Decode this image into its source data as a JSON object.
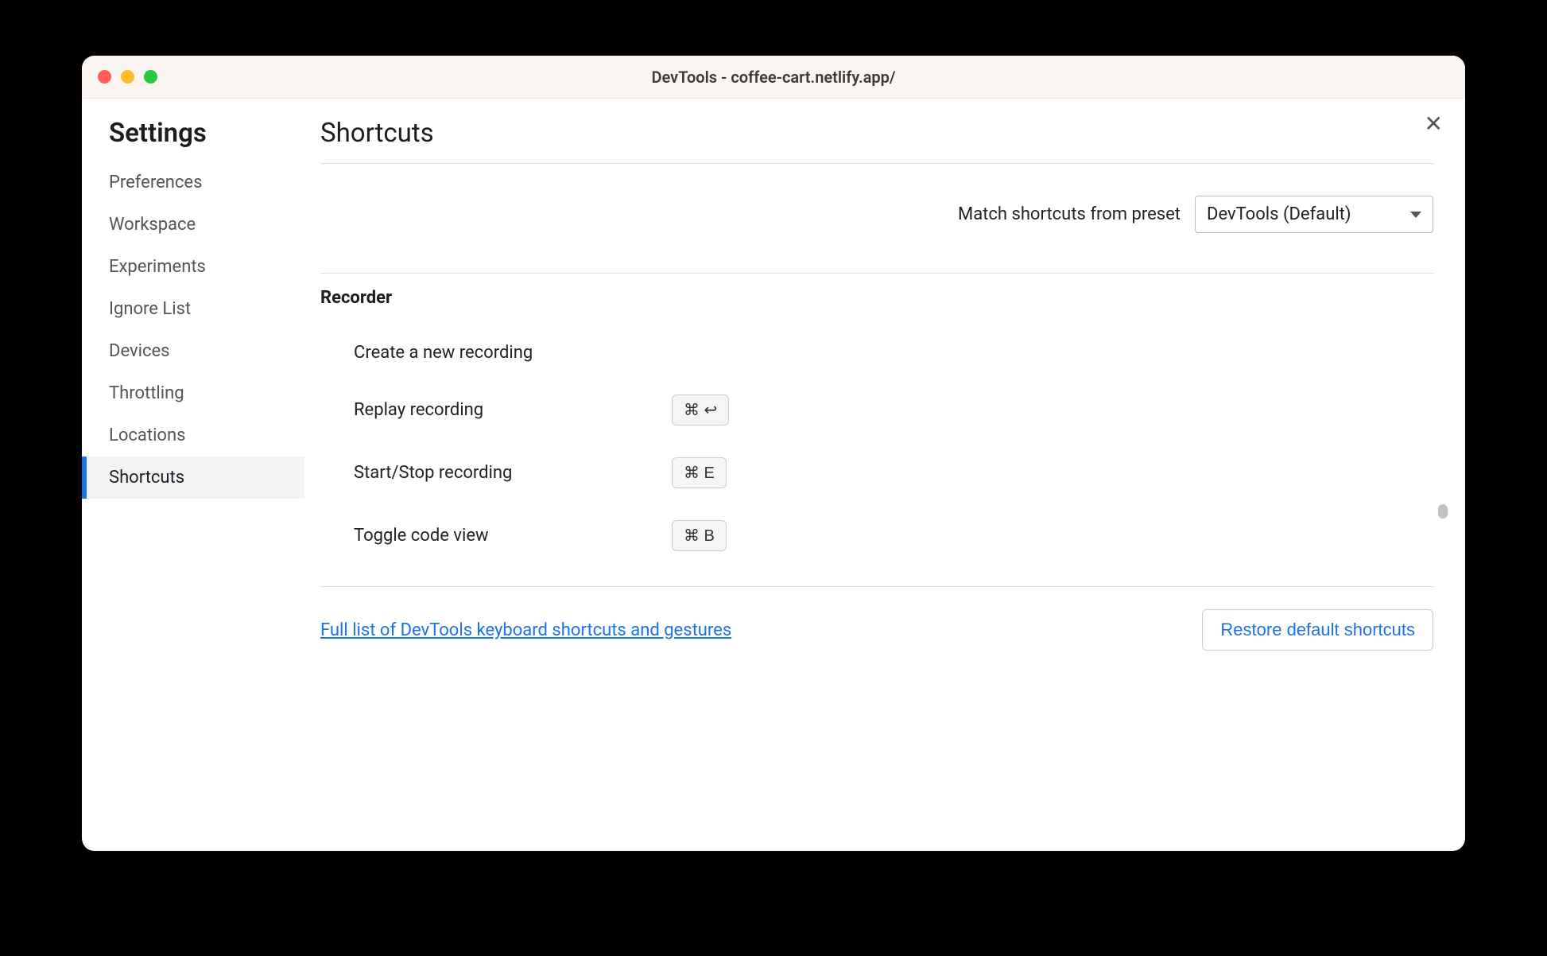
{
  "window": {
    "title": "DevTools - coffee-cart.netlify.app/"
  },
  "sidebar": {
    "title": "Settings",
    "items": [
      {
        "label": "Preferences",
        "active": false
      },
      {
        "label": "Workspace",
        "active": false
      },
      {
        "label": "Experiments",
        "active": false
      },
      {
        "label": "Ignore List",
        "active": false
      },
      {
        "label": "Devices",
        "active": false
      },
      {
        "label": "Throttling",
        "active": false
      },
      {
        "label": "Locations",
        "active": false
      },
      {
        "label": "Shortcuts",
        "active": true
      }
    ]
  },
  "main": {
    "title": "Shortcuts",
    "preset_label": "Match shortcuts from preset",
    "preset_value": "DevTools (Default)",
    "section": "Recorder",
    "shortcuts": [
      {
        "name": "Create a new recording",
        "keys": ""
      },
      {
        "name": "Replay recording",
        "keys": "⌘ ↩"
      },
      {
        "name": "Start/Stop recording",
        "keys": "⌘ E"
      },
      {
        "name": "Toggle code view",
        "keys": "⌘ B"
      }
    ],
    "link": "Full list of DevTools keyboard shortcuts and gestures",
    "restore_button": "Restore default shortcuts"
  }
}
